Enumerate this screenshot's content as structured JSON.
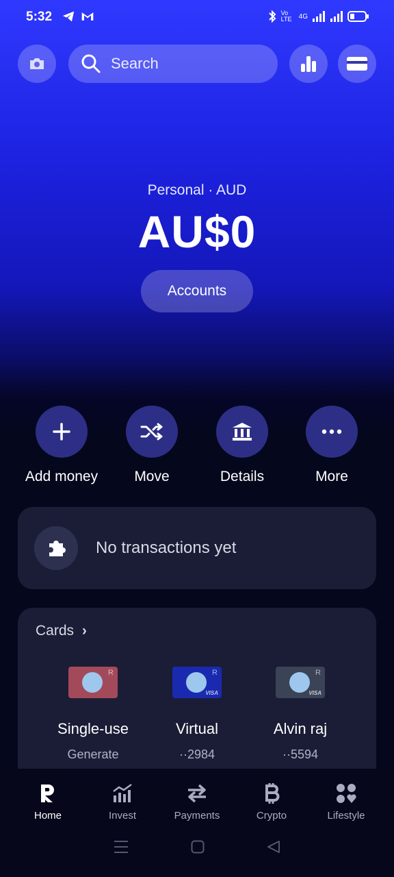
{
  "status": {
    "time": "5:32",
    "volte": "Vo LTE",
    "network": "4G"
  },
  "search": {
    "placeholder": "Search"
  },
  "balance": {
    "account_label": "Personal · AUD",
    "amount": "AU$0",
    "accounts_button": "Accounts"
  },
  "actions": [
    {
      "label": "Add money",
      "icon": "plus-icon"
    },
    {
      "label": "Move",
      "icon": "shuffle-icon"
    },
    {
      "label": "Details",
      "icon": "bank-icon"
    },
    {
      "label": "More",
      "icon": "more-icon"
    }
  ],
  "transactions": {
    "empty_text": "No transactions yet"
  },
  "cards": {
    "title": "Cards",
    "items": [
      {
        "name": "Single-use",
        "sub": "Generate",
        "color": "#a34a5a"
      },
      {
        "name": "Virtual",
        "sub": "··2984",
        "color": "#1a2ab0"
      },
      {
        "name": "Alvin raj",
        "sub": "··5594",
        "color": "#3b4357"
      }
    ]
  },
  "nav": [
    {
      "label": "Home",
      "icon": "revolut-logo-icon"
    },
    {
      "label": "Invest",
      "icon": "invest-chart-icon"
    },
    {
      "label": "Payments",
      "icon": "transfer-arrows-icon"
    },
    {
      "label": "Crypto",
      "icon": "bitcoin-icon"
    },
    {
      "label": "Lifestyle",
      "icon": "lifestyle-grid-icon"
    }
  ],
  "colors": {
    "accent": "#2f39ff",
    "panel": "#1b1d36",
    "background": "#05071c"
  }
}
